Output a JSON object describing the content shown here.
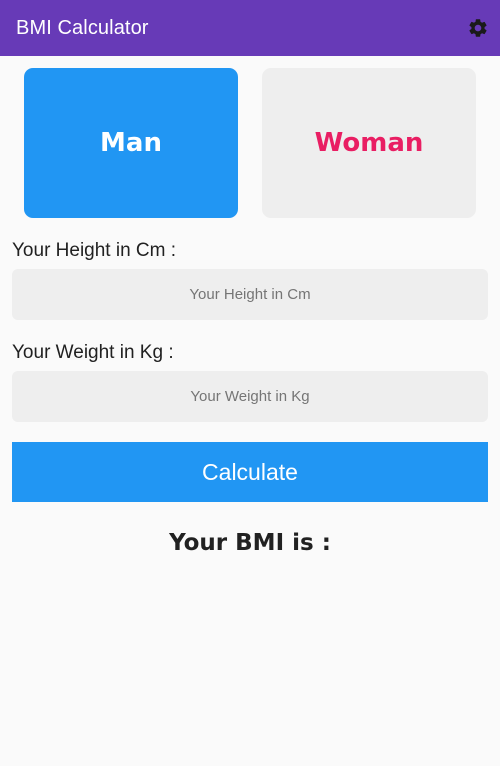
{
  "app_bar": {
    "title": "BMI Calculator",
    "settings_icon": "gear-icon",
    "color": "#673ab7"
  },
  "gender": {
    "man_label": "Man",
    "woman_label": "Woman",
    "selected": "Man",
    "selected_color": "#2196f3",
    "woman_text_color": "#e91e63"
  },
  "height": {
    "label": "Your Height in Cm :",
    "placeholder": "Your Height in Cm",
    "value": ""
  },
  "weight": {
    "label": "Your Weight in Kg :",
    "placeholder": "Your Weight in Kg",
    "value": ""
  },
  "calculate": {
    "label": "Calculate"
  },
  "result": {
    "label": "Your BMI is :"
  }
}
